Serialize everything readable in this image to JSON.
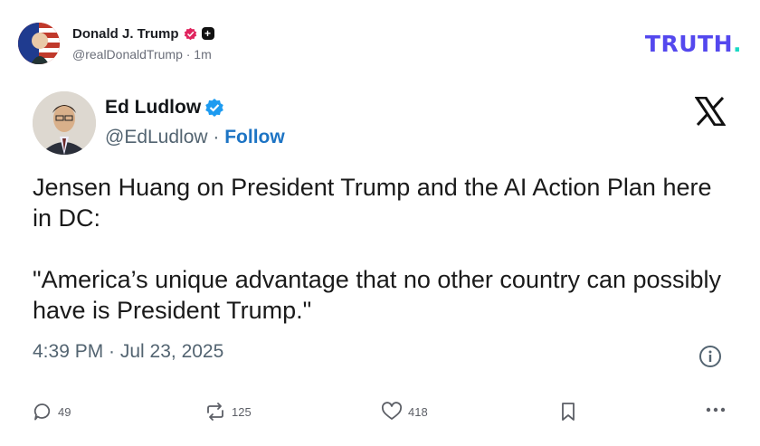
{
  "post": {
    "author_name": "Donald J. Trump",
    "handle_time": "@realDonaldTrump · 1m"
  },
  "brand": {
    "text": "TRUTH",
    "dot": "."
  },
  "tweet": {
    "name": "Ed Ludlow",
    "handle": "@EdLudlow · ",
    "follow_label": "Follow",
    "paragraph1": "Jensen Huang on President Trump and the AI Action Plan here in DC:",
    "paragraph2": "\"America’s unique advantage that no other country can possibly have is President Trump.\"",
    "timestamp": "4:39 PM · Jul 23, 2025"
  },
  "actions": {
    "replies": "49",
    "retruths": "125",
    "likes": "418"
  },
  "colors": {
    "brand": "#5448ee",
    "brand_dot": "#1ad8c4",
    "follow": "#1d74c4",
    "verified_red": "#e0245e",
    "verified_blue": "#1d9bf0"
  }
}
